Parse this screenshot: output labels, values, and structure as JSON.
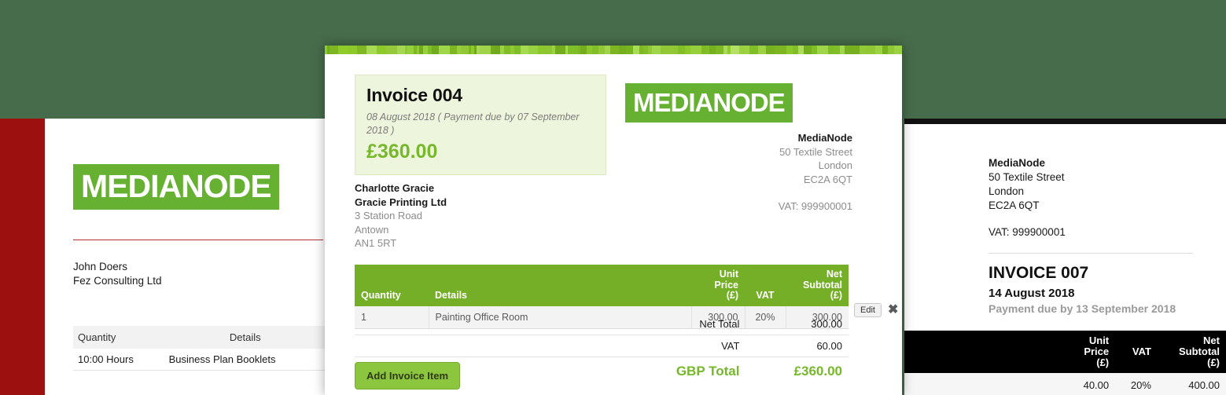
{
  "background_left": {
    "logo_text": "MEDIANODE",
    "customer": [
      "John Doers",
      "Fez Consulting Ltd"
    ],
    "table": {
      "headers": [
        "Quantity",
        "Details"
      ],
      "rows": [
        [
          "10:00 Hours",
          "Business Plan Booklets"
        ]
      ]
    }
  },
  "background_right": {
    "company": [
      "MediaNode",
      "50 Textile Street",
      "London",
      "EC2A 6QT"
    ],
    "vat": "VAT: 999900001",
    "invoice_title": "INVOICE 007",
    "invoice_date": "14 August 2018",
    "payment_due": "Payment due by 13 September 2018",
    "table": {
      "headers": [
        "",
        "Unit Price (£)",
        "VAT",
        "Net Subtotal (£)"
      ],
      "header_lines": {
        "unit_price": [
          "Unit",
          "Price",
          "(£)"
        ],
        "vat": [
          "VAT"
        ],
        "net_subtotal": [
          "Net",
          "Subtotal",
          "(£)"
        ]
      },
      "rows": [
        [
          "",
          "40.00",
          "20%",
          "400.00"
        ]
      ]
    }
  },
  "modal": {
    "summary": {
      "title": "Invoice 004",
      "dates": "08 August 2018   ( Payment due by 07 September 2018 )",
      "amount": "£360.00"
    },
    "logo_text": "MEDIANODE",
    "company": {
      "name": "MediaNode",
      "address": [
        "50 Textile Street",
        "London",
        "EC2A 6QT"
      ],
      "vat": "VAT: 999900001"
    },
    "customer": {
      "contact": "Charlotte Gracie",
      "company": "Gracie Printing Ltd",
      "address": [
        "3 Station Road",
        "Antown",
        "AN1 5RT"
      ]
    },
    "items_table": {
      "headers": {
        "quantity": "Quantity",
        "details": "Details",
        "unit_price": [
          "Unit",
          "Price",
          "(£)"
        ],
        "vat": "VAT",
        "net_subtotal": [
          "Net",
          "Subtotal",
          "(£)"
        ]
      },
      "rows": [
        {
          "quantity": "1",
          "details": "Painting Office Room",
          "unit_price": "300.00",
          "vat": "20%",
          "net_subtotal": "300.00",
          "edit_label": "Edit",
          "delete_label": "✖"
        }
      ]
    },
    "totals": {
      "net_total_label": "Net Total",
      "net_total_value": "300.00",
      "vat_label": "VAT",
      "vat_value": "60.00",
      "grand_label": "GBP Total",
      "grand_value": "£360.00"
    },
    "add_item_label": "Add Invoice Item"
  },
  "colors": {
    "page_background": "#476c4b",
    "brand_green": "#66b032",
    "table_header_green": "#74af27",
    "accent_green": "#76b82a",
    "button_green": "#8cc63e",
    "summary_bg": "#edf6dc",
    "sidebar_red": "#9c1010"
  }
}
